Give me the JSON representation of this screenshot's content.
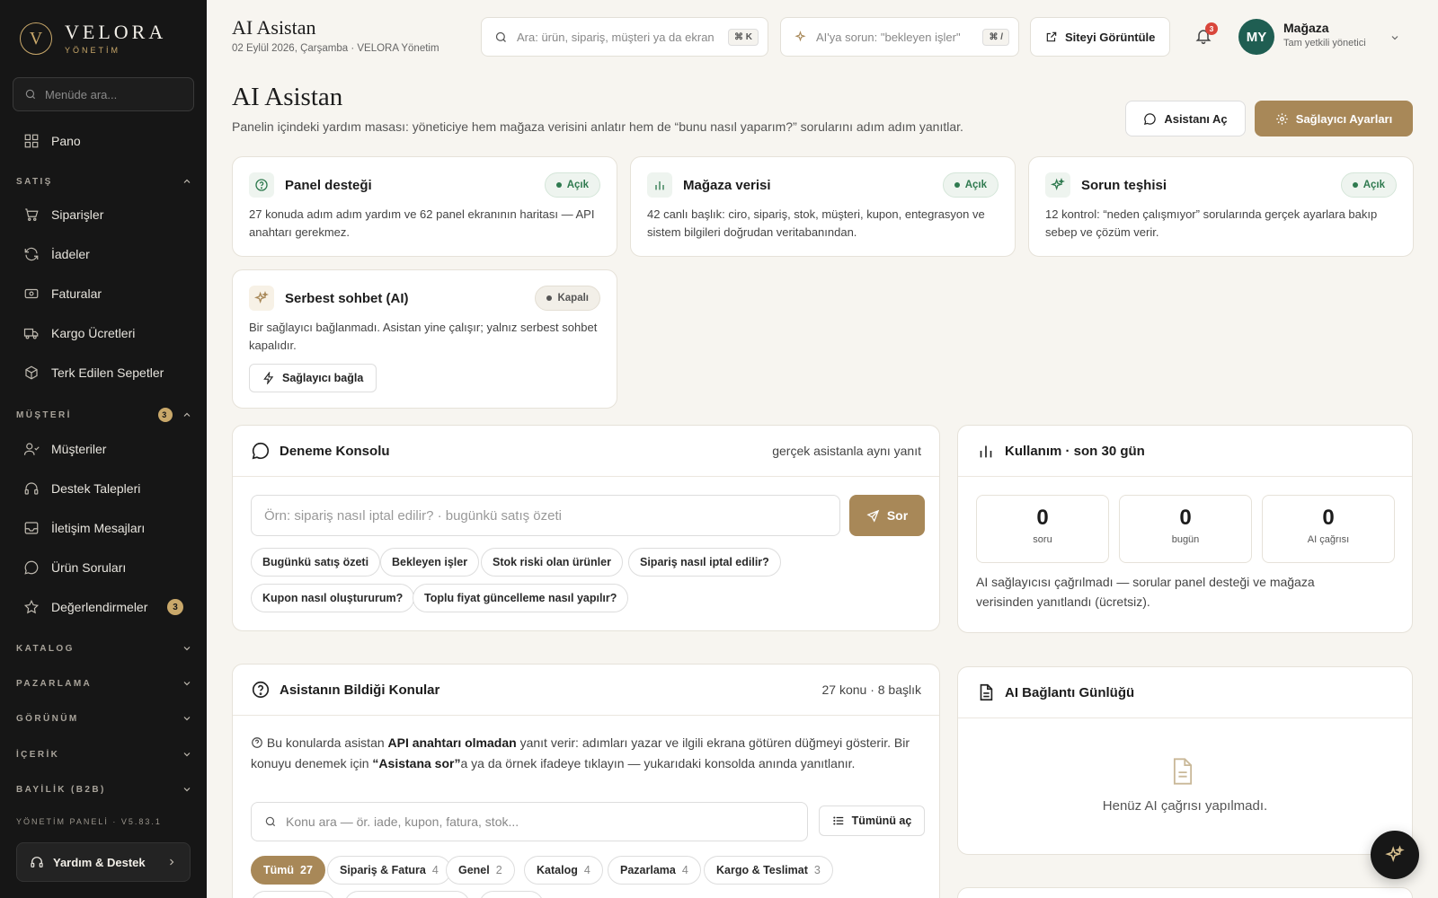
{
  "brand": {
    "logo_letter": "V",
    "name": "VELORA",
    "subtitle": "YÖNETİM"
  },
  "sidebar": {
    "search_placeholder": "Menüde ara...",
    "dashboard": "Pano",
    "section_sales": "SATIŞ",
    "sales_items": [
      "Siparişler",
      "İadeler",
      "Faturalar",
      "Kargo Ücretleri",
      "Terk Edilen Sepetler"
    ],
    "section_customer": "MÜŞTERİ",
    "section_customer_badge": "3",
    "customer_items": [
      "Müşteriler",
      "Destek Talepleri",
      "İletişim Mesajları",
      "Ürün Soruları",
      "Değerlendirmeler"
    ],
    "reviews_badge": "3",
    "collapsed_sections": [
      "KATALOG",
      "PAZARLAMA",
      "GÖRÜNÜM",
      "İÇERİK",
      "BAYİLİK (B2B)"
    ],
    "footer_version": "YÖNETİM PANELİ · V5.83.1",
    "help_button": "Yardım & Destek"
  },
  "topbar": {
    "title": "AI Asistan",
    "subtitle": "02 Eylül 2026, Çarşamba · VELORA Yönetim",
    "search_placeholder": "Ara: ürün, sipariş, müşteri ya da ekran",
    "search_shortcut": "⌘ K",
    "ai_placeholder": "AI'ya sorun: \"bekleyen işler\"",
    "ai_shortcut": "⌘ /",
    "view_site": "Siteyi Görüntüle",
    "notifications_count": "3",
    "avatar_initials": "MY",
    "user_name": "Mağaza",
    "user_role": "Tam yetkili yönetici"
  },
  "page": {
    "title": "AI Asistan",
    "description": "Panelin içindeki yardım masası: yöneticiye hem mağaza verisini anlatır hem de “bunu nasıl yaparım?” sorularını adım adım yanıtlar.",
    "open_assistant": "Asistanı Aç",
    "provider_settings": "Sağlayıcı Ayarları"
  },
  "features": [
    {
      "title": "Panel desteği",
      "status": "Açık",
      "desc": "27 konuda adım adım yardım ve 62 panel ekranının haritası — API anahtarı gerekmez."
    },
    {
      "title": "Mağaza verisi",
      "status": "Açık",
      "desc": "42 canlı başlık: ciro, sipariş, stok, müşteri, kupon, entegrasyon ve sistem bilgileri doğrudan veritabanından."
    },
    {
      "title": "Sorun teşhisi",
      "status": "Açık",
      "desc": "12 kontrol: “neden çalışmıyor” sorularında gerçek ayarlara bakıp sebep ve çözüm verir."
    },
    {
      "title": "Serbest sohbet (AI)",
      "status": "Kapalı",
      "desc": "Bir sağlayıcı bağlanmadı. Asistan yine çalışır; yalnız serbest sohbet kapalıdır.",
      "action": "Sağlayıcı bağla"
    }
  ],
  "console": {
    "title": "Deneme Konsolu",
    "meta": "gerçek asistanla aynı yanıt",
    "placeholder": "Örn: sipariş nasıl iptal edilir? · bugünkü satış özeti",
    "ask": "Sor",
    "suggestions": [
      "Bugünkü satış özeti",
      "Bekleyen işler",
      "Stok riski olan ürünler",
      "Sipariş nasıl iptal edilir?",
      "Kupon nasıl oluştururum?",
      "Toplu fiyat güncelleme nasıl yapılır?"
    ]
  },
  "usage": {
    "title": "Kullanım · son 30 gün",
    "stats": [
      {
        "value": "0",
        "label": "soru"
      },
      {
        "value": "0",
        "label": "bugün"
      },
      {
        "value": "0",
        "label": "AI çağrısı"
      }
    ],
    "note": "AI sağlayıcısı çağrılmadı — sorular panel desteği ve mağaza verisinden yanıtlandı (ücretsiz)."
  },
  "topics": {
    "title": "Asistanın Bildiği Konular",
    "meta": "27 konu · 8 başlık",
    "intro_a": "Bu konularda asistan ",
    "intro_b": "API anahtarı olmadan",
    "intro_c": " yanıt verir: adımları yazar ve ilgili ekrana götüren düğmeyi gösterir. Bir konuyu denemek için ",
    "intro_d": "“Asistana sor”",
    "intro_e": "a ya da örnek ifadeye tıklayın — yukarıdaki konsolda anında yanıtlanır.",
    "search_placeholder": "Konu ara — ör. iade, kupon, fatura, stok...",
    "expand_all": "Tümünü aç",
    "filters": [
      {
        "label": "Tümü",
        "count": "27"
      },
      {
        "label": "Sipariş & Fatura",
        "count": "4"
      },
      {
        "label": "Genel",
        "count": "2"
      },
      {
        "label": "Katalog",
        "count": "4"
      },
      {
        "label": "Pazarlama",
        "count": "4"
      },
      {
        "label": "Kargo & Teslimat",
        "count": "3"
      }
    ]
  },
  "log": {
    "title": "AI Bağlantı Günlüğü",
    "empty": "Henüz AI çağrısı yapılmadı."
  },
  "colors": {
    "accent": "#a88858",
    "sidebar_bg": "#161616",
    "success": "#2f7a4f",
    "avatar": "#1f5e52"
  }
}
